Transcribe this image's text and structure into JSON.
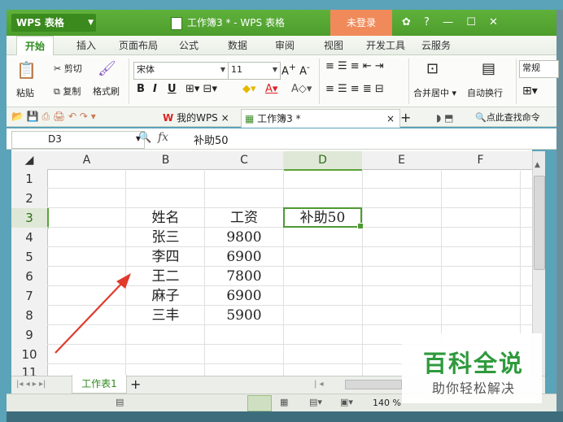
{
  "app": {
    "menu_button": "WPS 表格",
    "title": "工作簿3 * - WPS 表格",
    "login": "未登录",
    "title_controls": [
      "?",
      "—",
      "☐",
      "✕"
    ]
  },
  "menu": [
    "开始",
    "插入",
    "页面布局",
    "公式",
    "数据",
    "审阅",
    "视图",
    "开发工具",
    "云服务"
  ],
  "ribbon": {
    "paste": "粘贴",
    "cut": "剪切",
    "copy": "复制",
    "format_painter": "格式刷",
    "font_name": "宋体",
    "font_size": "11",
    "bold": "B",
    "italic": "I",
    "underline": "U",
    "merge_center": "合并居中",
    "wrap_text": "自动换行",
    "number_format": "常规"
  },
  "tabs": {
    "mywps": "我的WPS",
    "workbook": "工作簿3 *",
    "search": "点此查找命令"
  },
  "formula": {
    "cell_ref": "D3",
    "fx": "fx",
    "content": "补助50"
  },
  "grid": {
    "columns": [
      "A",
      "B",
      "C",
      "D",
      "E",
      "F"
    ],
    "rows": [
      "1",
      "2",
      "3",
      "4",
      "5",
      "6",
      "7",
      "8",
      "9",
      "10",
      "11"
    ],
    "cells": {
      "B3": "姓名",
      "C3": "工资",
      "D3": "补助50",
      "B4": "张三",
      "C4": "9800",
      "B5": "李四",
      "C5": "6900",
      "B6": "王二",
      "C6": "7800",
      "B7": "麻子",
      "C7": "6900",
      "B8": "三丰",
      "C8": "5900"
    }
  },
  "sheet_tab": "工作表1",
  "status": {
    "zoom": "140 %"
  },
  "watermark": {
    "title": "百科全说",
    "subtitle": "助你轻松解决"
  },
  "colors": {
    "accent_green": "#4e9a33",
    "annotation_arrow": "#e03a2c"
  }
}
